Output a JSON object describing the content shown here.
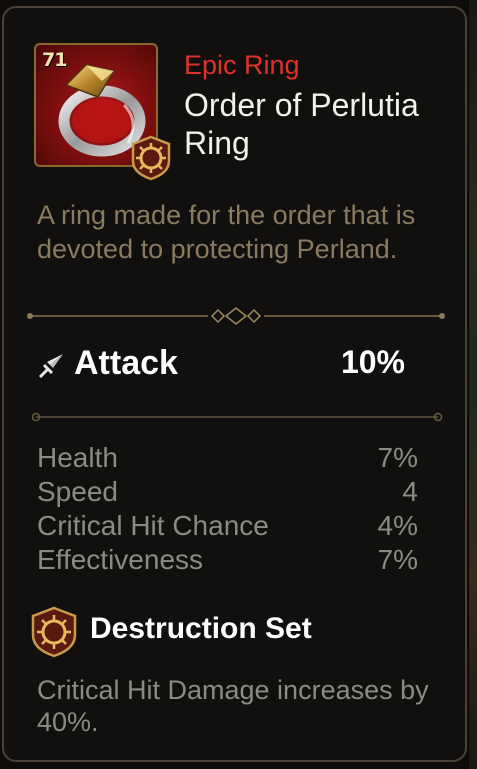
{
  "item": {
    "level": "71",
    "rarity": "Epic Ring",
    "name": "Order of Perlutia Ring",
    "description": "A ring made for the order that is devoted to protecting Perland."
  },
  "main_stat": {
    "icon": "sword-icon",
    "label": "Attack",
    "value": "10%"
  },
  "substats": [
    {
      "label": "Health",
      "value": "7%"
    },
    {
      "label": "Speed",
      "value": "4"
    },
    {
      "label": "Critical Hit Chance",
      "value": "4%"
    },
    {
      "label": "Effectiveness",
      "value": "7%"
    }
  ],
  "set": {
    "icon": "destruction-set-icon",
    "name": "Destruction Set",
    "effect": "Critical Hit Damage increases by 40%."
  },
  "colors": {
    "rarity": "#e0322a",
    "frame": "#8a6a2c",
    "panel_border": "#4a4236",
    "description_text": "#8a7a60",
    "substat_text": "#8c8a84"
  }
}
